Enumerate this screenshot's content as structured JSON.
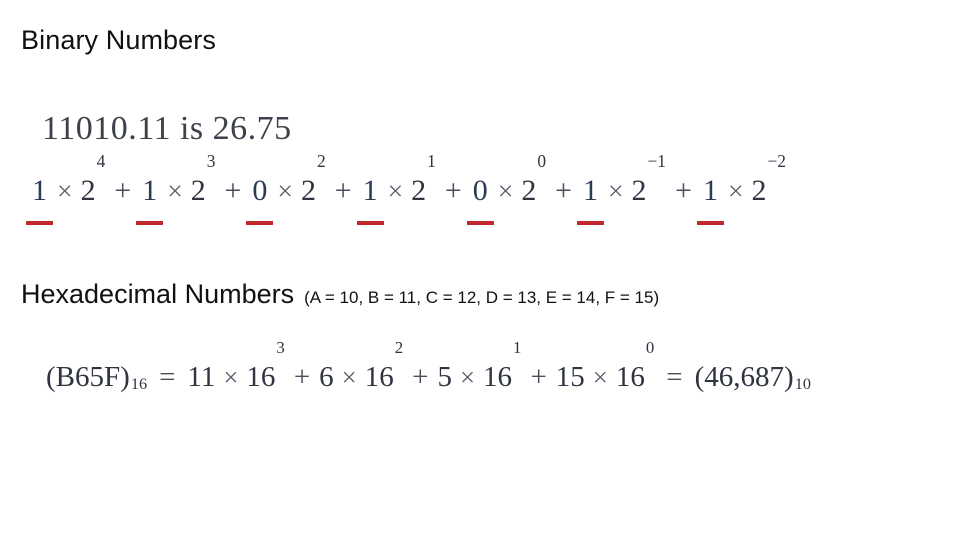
{
  "slide": {
    "background_color": "#ffffff",
    "underline_color": "#c0272d",
    "math_text_color": "#2f3440",
    "heading_text_color": "#111111"
  },
  "binary_section": {
    "heading": "Binary Numbers",
    "value_line": {
      "binary": "11010.11",
      "connector": "is",
      "decimal": "26.75",
      "full_text": "11010.11 is 26.75"
    },
    "expansion": {
      "base": "2",
      "full_text": "1 × 2⁴ + 1 × 2³ + 0 × 2² + 1 × 2¹ + 0 × 2⁰ + 1 × 2⁻¹ + 1 × 2⁻²",
      "terms": [
        {
          "coefficient": "1",
          "exponent": "4",
          "underlined": true
        },
        {
          "coefficient": "1",
          "exponent": "3",
          "underlined": true
        },
        {
          "coefficient": "0",
          "exponent": "2",
          "underlined": true
        },
        {
          "coefficient": "1",
          "exponent": "1",
          "underlined": true
        },
        {
          "coefficient": "0",
          "exponent": "0",
          "underlined": true
        },
        {
          "coefficient": "1",
          "exponent": "−1",
          "underlined": true
        },
        {
          "coefficient": "1",
          "exponent": "−2",
          "underlined": true
        }
      ],
      "operator_plus": "+",
      "operator_times": "×"
    }
  },
  "hex_section": {
    "heading": "Hexadecimal Numbers",
    "heading_note": "(A = 10, B = 11, C = 12, D = 13, E = 14, F = 15)",
    "equation": {
      "full_text": "(B65F)₁₆ = 11 × 16³ + 6 × 16² + 5 × 16¹ + 15 × 16⁰ = (46,687)₁₀",
      "left_open": "(",
      "left_value": "B65F",
      "left_close": ")",
      "left_subscript": "16",
      "base": "16",
      "terms": [
        {
          "coefficient": "11",
          "exponent": "3"
        },
        {
          "coefficient": "6",
          "exponent": "2"
        },
        {
          "coefficient": "5",
          "exponent": "1"
        },
        {
          "coefficient": "15",
          "exponent": "0"
        }
      ],
      "result_open": "(",
      "result_value": "46,687",
      "result_close": ")",
      "result_subscript": "10",
      "operator_plus": "+",
      "operator_times": "×",
      "operator_equals": "="
    }
  }
}
